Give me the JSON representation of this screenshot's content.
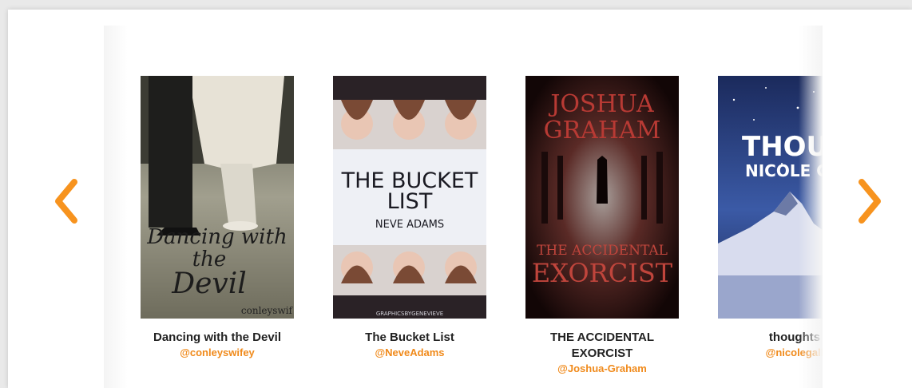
{
  "carousel": {
    "prev_icon": "chevron-left-icon",
    "next_icon": "chevron-right-icon",
    "accent_color": "#f7931e",
    "books": [
      {
        "title": "Dancing with the Devil",
        "author": "@conleyswifey",
        "cover_text": [
          "Dancing with",
          "the",
          "Devil"
        ],
        "cover_credit": "conleyswif"
      },
      {
        "title": "The Bucket List",
        "author": "@NeveAdams",
        "cover_text": [
          "THE BUCKET",
          "LIST"
        ],
        "cover_author": "NEVE ADAMS",
        "cover_credit": "GRAPHICSBYGENEVIEVE"
      },
      {
        "title": "THE ACCIDENTAL EXORCIST",
        "author": "@Joshua-Graham",
        "cover_author_lines": [
          "JOSHUA",
          "GRAHAM"
        ],
        "cover_text": [
          "THE ACCIDENTAL",
          "EXORCIST"
        ]
      },
      {
        "title": "thoughts",
        "author": "@nicolegall",
        "cover_text": [
          "THOUGH"
        ],
        "cover_author": "NICOLE GAL"
      }
    ]
  }
}
